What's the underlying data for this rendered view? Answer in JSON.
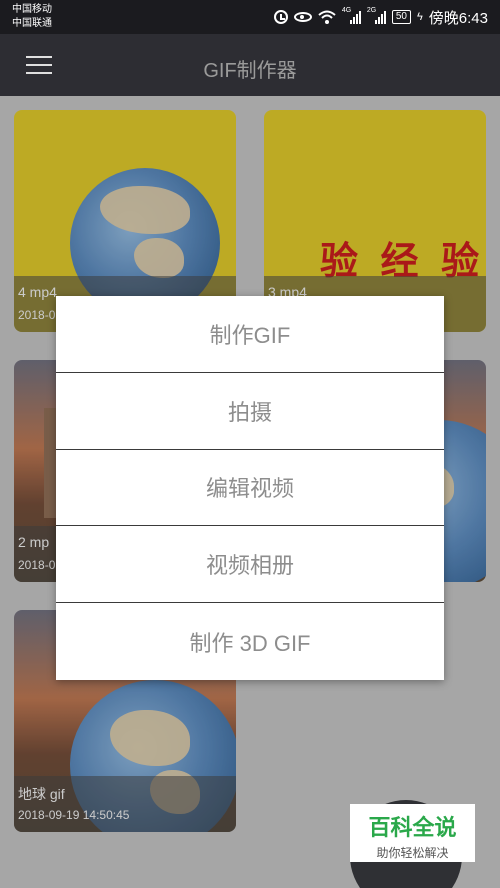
{
  "status_bar": {
    "carrier1": "中国移动",
    "carrier2": "中国联通",
    "signal1_tag": "4G",
    "signal2_tag": "2G",
    "battery": "50",
    "time": "傍晚6:43"
  },
  "app_bar": {
    "title": "GIF制作器",
    "menu_icon": "hamburger-menu-icon"
  },
  "cards": [
    {
      "name": "4 mp4",
      "date": "2018-0",
      "thumb": "globe-on-yellow"
    },
    {
      "name": "3 mp4",
      "date": "",
      "thumb": "red-text-on-yellow"
    },
    {
      "name": "2 mp",
      "date": "2018-0",
      "thumb": "city-sunset"
    },
    {
      "name": "",
      "date": "",
      "thumb": "globe-sunset"
    },
    {
      "name": "地球 gif",
      "date": "2018-09-19 14:50:45",
      "thumb": "globe-sunset"
    }
  ],
  "card2_image_text": "验 经 验",
  "dialog": {
    "items": [
      "制作GIF",
      "拍摄",
      "编辑视频",
      "视频相册",
      "制作 3D GIF"
    ]
  },
  "watermark": {
    "title": "百科全说",
    "subtitle": "助你轻松解决"
  },
  "colors": {
    "app_bar": "#2d2d33",
    "status_bar": "#1b1b1f",
    "card_yellow": "#d8c22a",
    "dialog_text": "#8d8d8d",
    "watermark_green": "#2aa84a"
  }
}
